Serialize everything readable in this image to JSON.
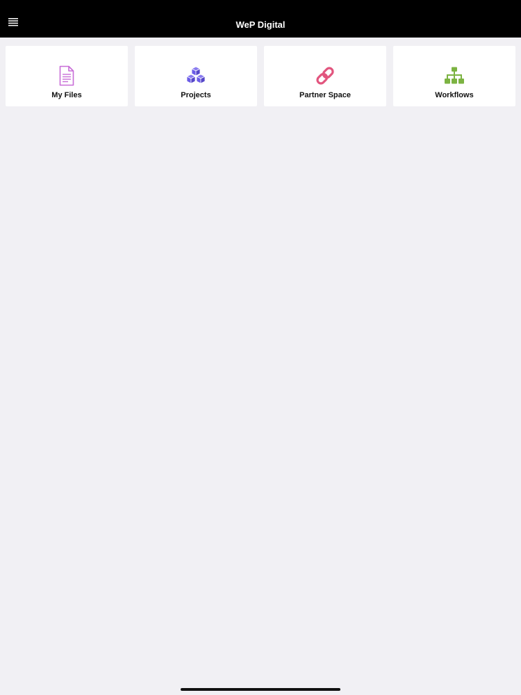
{
  "header": {
    "title": "WeP Digital",
    "menu_icon": "hamburger-menu-icon"
  },
  "tiles": [
    {
      "label": "My Files",
      "icon": "document-icon",
      "color": "#c86dd7"
    },
    {
      "label": "Projects",
      "icon": "cubes-icon",
      "color": "#6b5ce7"
    },
    {
      "label": "Partner Space",
      "icon": "link-icon",
      "color": "#e2557e"
    },
    {
      "label": "Workflows",
      "icon": "sitemap-icon",
      "color": "#7cb342"
    }
  ],
  "colors": {
    "header_bg": "#000000",
    "page_bg": "#f1f0f4",
    "tile_bg": "#ffffff"
  }
}
